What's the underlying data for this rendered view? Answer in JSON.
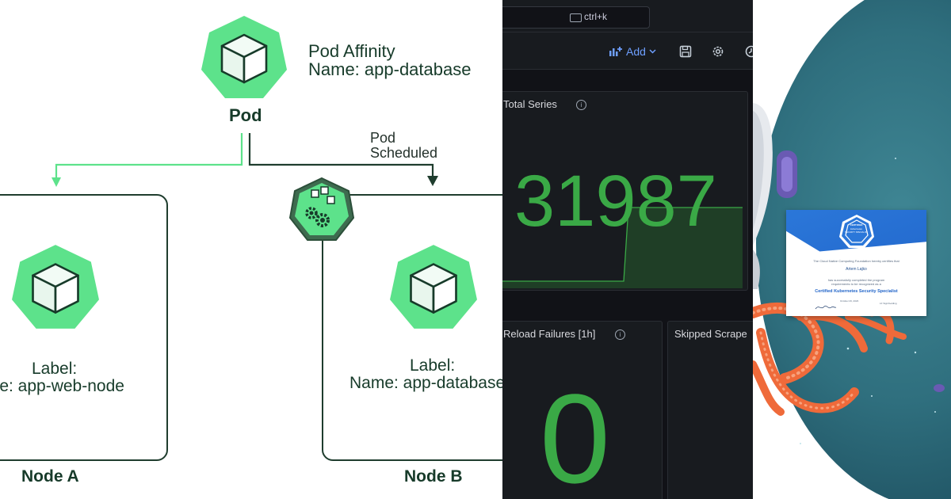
{
  "diagram": {
    "pod_affinity_title": "Pod Affinity",
    "pod_affinity_name": "Name: app-database",
    "pod_label": "Pod",
    "scheduled_line1": "Pod",
    "scheduled_line2": "Scheduled",
    "node_a": {
      "label_line1": "Label:",
      "label_line2": "Name: app-web-node",
      "title": "Node A"
    },
    "node_b": {
      "label_line1": "Label:",
      "label_line2": "Name: app-database",
      "title": "Node B"
    },
    "colors": {
      "green": "#5de28b",
      "dark": "#1f3d2e",
      "scheduler": "#3e6b4f"
    },
    "icons": [
      "cube-icon",
      "scheduler-icon"
    ]
  },
  "dashboard": {
    "search_shortcut": "ctrl+k",
    "add_label": "Add",
    "panels": [
      {
        "title": "Total Series",
        "value": "31987"
      },
      {
        "title": "Reload Failures [1h]",
        "value": "0"
      },
      {
        "title": "Skipped Scrape",
        "value": ""
      }
    ],
    "colors": {
      "value_green": "#3aa946",
      "link_blue": "#6e9fff",
      "bg": "#111217"
    },
    "icons": [
      "keyboard-icon",
      "panel-add-icon",
      "chevron-down-icon",
      "save-icon",
      "gear-icon",
      "info-icon"
    ]
  },
  "certificate": {
    "badge_top": "CERTIFIED",
    "badge_mid": "kubernetes",
    "badge_bot": "SECURITY SPECIALIST",
    "intro": "The Cloud Native Computing Foundation hereby certifies that",
    "recipient": "Artem Lajko",
    "body": "has successfully completed the program requirements to be recognized as a",
    "title": "Certified Kubernetes Security Specialist",
    "date": "October 26, 2023",
    "signer": "LF Sign/Gelding",
    "colors": {
      "blue": "#2b77d9",
      "teal": "#2f6f7e",
      "orange": "#ef6a3a"
    }
  }
}
